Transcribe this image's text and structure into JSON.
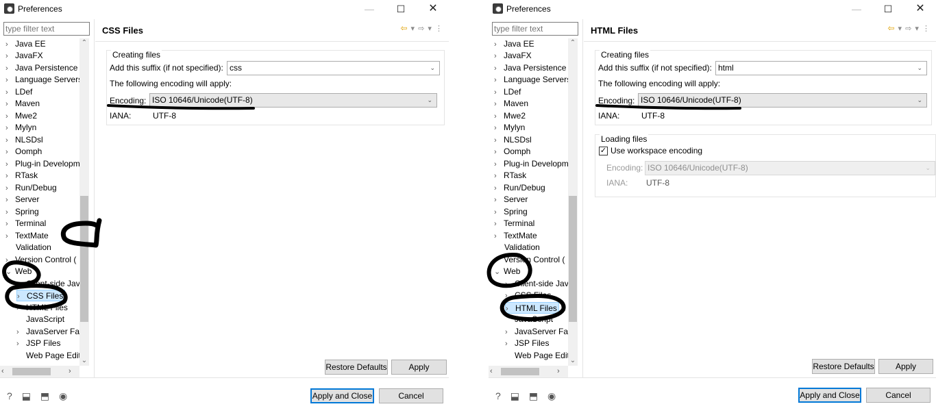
{
  "left": {
    "title": "Preferences",
    "filter_placeholder": "type filter text",
    "tree": [
      {
        "label": "Java EE",
        "arrow": "›"
      },
      {
        "label": "JavaFX",
        "arrow": "›"
      },
      {
        "label": "Java Persistence",
        "arrow": "›"
      },
      {
        "label": "Language Servers",
        "arrow": "›"
      },
      {
        "label": "LDef",
        "arrow": "›"
      },
      {
        "label": "Maven",
        "arrow": "›"
      },
      {
        "label": "Mwe2",
        "arrow": "›"
      },
      {
        "label": "Mylyn",
        "arrow": "›"
      },
      {
        "label": "NLSDsl",
        "arrow": "›"
      },
      {
        "label": "Oomph",
        "arrow": "›"
      },
      {
        "label": "Plug-in Developm",
        "arrow": "›"
      },
      {
        "label": "RTask",
        "arrow": "›"
      },
      {
        "label": "Run/Debug",
        "arrow": "›"
      },
      {
        "label": "Server",
        "arrow": "›"
      },
      {
        "label": "Spring",
        "arrow": "›"
      },
      {
        "label": "Terminal",
        "arrow": "›"
      },
      {
        "label": "TextMate",
        "arrow": "›"
      },
      {
        "label": "Validation",
        "arrow": ""
      },
      {
        "label": "Version Control (",
        "arrow": "›"
      },
      {
        "label": "Web",
        "arrow": "⌄"
      },
      {
        "label": "Client-side Java",
        "arrow": "›"
      },
      {
        "label": "CSS Files",
        "arrow": "›"
      },
      {
        "label": "HTML Files",
        "arrow": "›"
      },
      {
        "label": "JavaScript",
        "arrow": ""
      },
      {
        "label": "JavaServer Face",
        "arrow": "›"
      },
      {
        "label": "JSP Files",
        "arrow": "›"
      },
      {
        "label": "Web Page Edit",
        "arrow": ""
      }
    ],
    "page_title": "CSS Files",
    "group_creating_title": "Creating files",
    "suffix_label": "Add this suffix (if not specified):",
    "suffix_value": "css",
    "following_label": "The following encoding will apply:",
    "encoding_label": "Encoding:",
    "encoding_value": "ISO 10646/Unicode(UTF-8)",
    "iana_label": "IANA:",
    "iana_value": "UTF-8",
    "restore_label": "Restore Defaults",
    "apply_label": "Apply",
    "apply_close_label": "Apply and Close",
    "cancel_label": "Cancel"
  },
  "right": {
    "title": "Preferences",
    "filter_placeholder": "type filter text",
    "tree": [
      {
        "label": "Java EE",
        "arrow": "›"
      },
      {
        "label": "JavaFX",
        "arrow": "›"
      },
      {
        "label": "Java Persistence",
        "arrow": "›"
      },
      {
        "label": "Language Servers",
        "arrow": "›"
      },
      {
        "label": "LDef",
        "arrow": "›"
      },
      {
        "label": "Maven",
        "arrow": "›"
      },
      {
        "label": "Mwe2",
        "arrow": "›"
      },
      {
        "label": "Mylyn",
        "arrow": "›"
      },
      {
        "label": "NLSDsl",
        "arrow": "›"
      },
      {
        "label": "Oomph",
        "arrow": "›"
      },
      {
        "label": "Plug-in Developm",
        "arrow": "›"
      },
      {
        "label": "RTask",
        "arrow": "›"
      },
      {
        "label": "Run/Debug",
        "arrow": "›"
      },
      {
        "label": "Server",
        "arrow": "›"
      },
      {
        "label": "Spring",
        "arrow": "›"
      },
      {
        "label": "Terminal",
        "arrow": "›"
      },
      {
        "label": "TextMate",
        "arrow": "›"
      },
      {
        "label": "Validation",
        "arrow": ""
      },
      {
        "label": "Version Control (",
        "arrow": "›"
      },
      {
        "label": "Web",
        "arrow": "⌄"
      },
      {
        "label": "Client-side Java",
        "arrow": "›"
      },
      {
        "label": "CSS Files",
        "arrow": "›"
      },
      {
        "label": "HTML Files",
        "arrow": "›"
      },
      {
        "label": "JavaScript",
        "arrow": ""
      },
      {
        "label": "JavaServer Face",
        "arrow": "›"
      },
      {
        "label": "JSP Files",
        "arrow": "›"
      },
      {
        "label": "Web Page Edit",
        "arrow": ""
      }
    ],
    "page_title": "HTML Files",
    "group_creating_title": "Creating files",
    "suffix_label": "Add this suffix (if not specified):",
    "suffix_value": "html",
    "following_label": "The following encoding will apply:",
    "encoding_label": "Encoding:",
    "encoding_value": "ISO 10646/Unicode(UTF-8)",
    "iana_label": "IANA:",
    "iana_value": "UTF-8",
    "group_loading_title": "Loading files",
    "use_workspace_label": "Use workspace encoding",
    "use_workspace_checked": true,
    "load_encoding_label": "Encoding:",
    "load_encoding_value": "ISO 10646/Unicode(UTF-8)",
    "load_iana_label": "IANA:",
    "load_iana_value": "UTF-8",
    "restore_label": "Restore Defaults",
    "apply_label": "Apply",
    "apply_close_label": "Apply and Close",
    "cancel_label": "Cancel"
  },
  "icons": {
    "window_minimize": "—",
    "window_maximize": "☐",
    "window_close": "✕",
    "nav_back": "⇦",
    "nav_forward": "⇨",
    "dropdown": "▾",
    "view_menu": "⋮",
    "help": "?",
    "import": "⬓",
    "export": "⬒",
    "oomph": "◉",
    "combo_arrow": "⌄",
    "check": "✓"
  },
  "colors": {
    "selection": "#cce8ff",
    "default_button_border": "#0078d7",
    "ink": "#000000"
  }
}
